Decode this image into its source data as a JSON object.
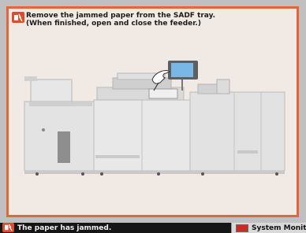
{
  "message": {
    "line1": "Remove the jammed paper from the SADF tray.",
    "line2": "(When finished, open and close the feeder.)"
  },
  "status_bar": {
    "text": "The paper has jammed.",
    "system_monitor_label": "System Monitor"
  },
  "icons": {
    "message_icon": "paper-jam-icon",
    "status_icon": "paper-jam-icon",
    "system_monitor_icon": "system-monitor-icon",
    "diagram_hand": "pointing-hand-icon"
  },
  "colors": {
    "panel_border": "#e7643a",
    "jam_badge": "#e14b2d",
    "system_monitor_indicator": "#c92c22"
  }
}
